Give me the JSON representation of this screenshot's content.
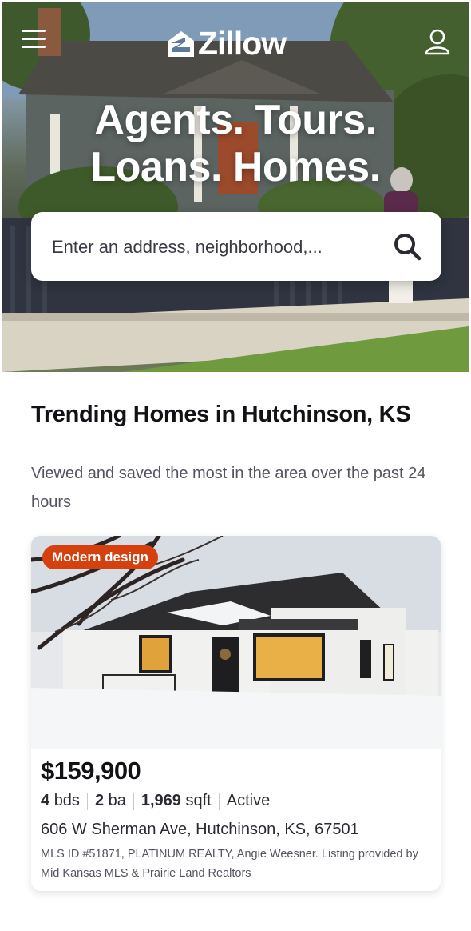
{
  "header": {
    "logo_text": "Zillow",
    "menu_icon": "hamburger-menu-icon",
    "profile_icon": "user-profile-icon"
  },
  "hero": {
    "headline_line1": "Agents. Tours.",
    "headline_line2": "Loans. Homes.",
    "search_placeholder": "Enter an address, neighborhood,...",
    "search_icon": "search-icon"
  },
  "trending": {
    "title": "Trending Homes in Hutchinson, KS",
    "subtitle": "Viewed and saved the most in the area over the past 24 hours"
  },
  "listing": {
    "badge": "Modern design",
    "price": "$159,900",
    "beds_value": "4",
    "beds_unit": "bds",
    "baths_value": "2",
    "baths_unit": "ba",
    "sqft_value": "1,969",
    "sqft_unit": "sqft",
    "status": "Active",
    "address": "606 W Sherman Ave, Hutchinson, KS, 67501",
    "mls_text": "MLS ID #51871, PLATINUM REALTY, Angie Weesner. Listing provided by Mid Kansas MLS & Prairie Land Realtors"
  },
  "colors": {
    "badge_bg": "#d4410f",
    "text_primary": "#111116",
    "text_secondary": "#545460"
  }
}
